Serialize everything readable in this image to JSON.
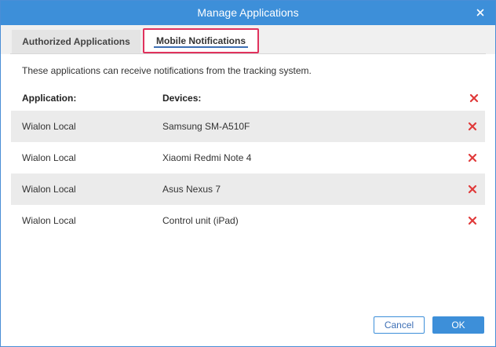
{
  "window": {
    "title": "Manage Applications"
  },
  "tabs": [
    {
      "label": "Authorized Applications",
      "active": false
    },
    {
      "label": "Mobile Notifications",
      "active": true
    }
  ],
  "description": "These applications can receive notifications from the tracking system.",
  "table": {
    "headers": {
      "application": "Application:",
      "devices": "Devices:"
    },
    "rows": [
      {
        "application": "Wialon Local",
        "device": "Samsung SM-A510F"
      },
      {
        "application": "Wialon Local",
        "device": "Xiaomi Redmi Note 4"
      },
      {
        "application": "Wialon Local",
        "device": "Asus Nexus 7"
      },
      {
        "application": "Wialon Local",
        "device": "Control unit (iPad)"
      }
    ]
  },
  "buttons": {
    "cancel": "Cancel",
    "ok": "OK"
  },
  "colors": {
    "titlebar": "#3d8fd9",
    "delete": "#e03a3a",
    "highlight": "#e0325d"
  }
}
